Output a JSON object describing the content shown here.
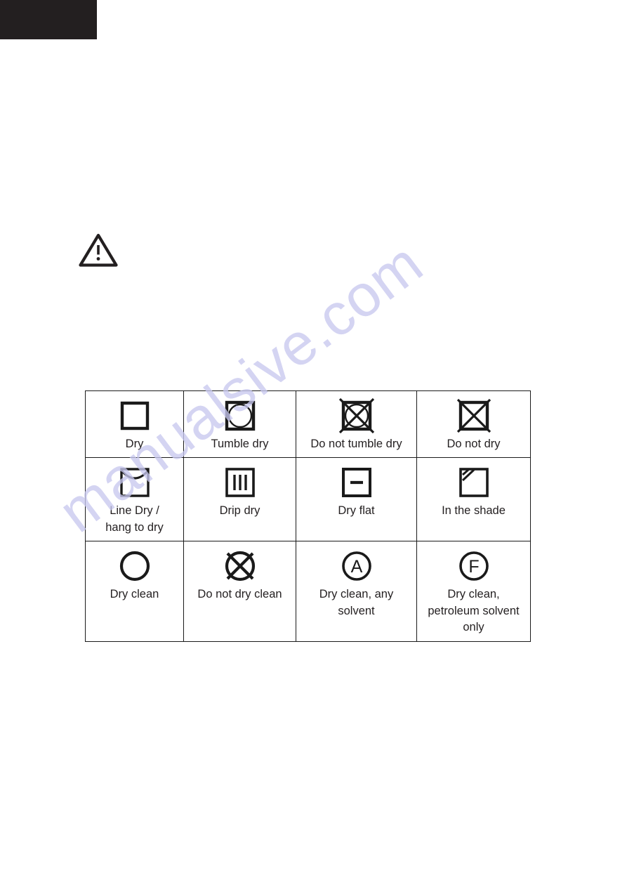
{
  "page": {
    "background_color": "#ffffff",
    "header_bar_color": "#231f20",
    "ink_color": "#231f20"
  },
  "watermark": {
    "text": "manualsive.com",
    "color": "#c8c8ef",
    "rotation_deg": -37
  },
  "warning": {
    "icon": "warning-triangle-exclamation",
    "label": ""
  },
  "symbols_table": {
    "rows": [
      {
        "cells": [
          {
            "icon": "square-dry-icon",
            "label": "Dry"
          },
          {
            "icon": "tumble-dry-icon",
            "label": "Tumble dry"
          },
          {
            "icon": "do-not-tumble-dry-icon",
            "label": "Do not tumble dry"
          },
          {
            "icon": "do-not-dry-icon",
            "label": "Do not dry"
          }
        ]
      },
      {
        "cells": [
          {
            "icon": "line-dry-icon",
            "label": "Line Dry /\nhang to dry"
          },
          {
            "icon": "drip-dry-icon",
            "label": "Drip dry"
          },
          {
            "icon": "dry-flat-icon",
            "label": "Dry flat"
          },
          {
            "icon": "in-the-shade-icon",
            "label": "In the shade"
          }
        ]
      },
      {
        "cells": [
          {
            "icon": "dry-clean-icon",
            "label": "Dry clean"
          },
          {
            "icon": "do-not-dry-clean-icon",
            "label": "Do not dry clean"
          },
          {
            "icon": "dry-clean-any-solvent-icon",
            "label": "Dry clean, any\nsolvent",
            "letter": "A"
          },
          {
            "icon": "dry-clean-petroleum-icon",
            "label": "Dry clean,\npetroleum solvent\nonly",
            "letter": "F"
          }
        ]
      }
    ]
  }
}
